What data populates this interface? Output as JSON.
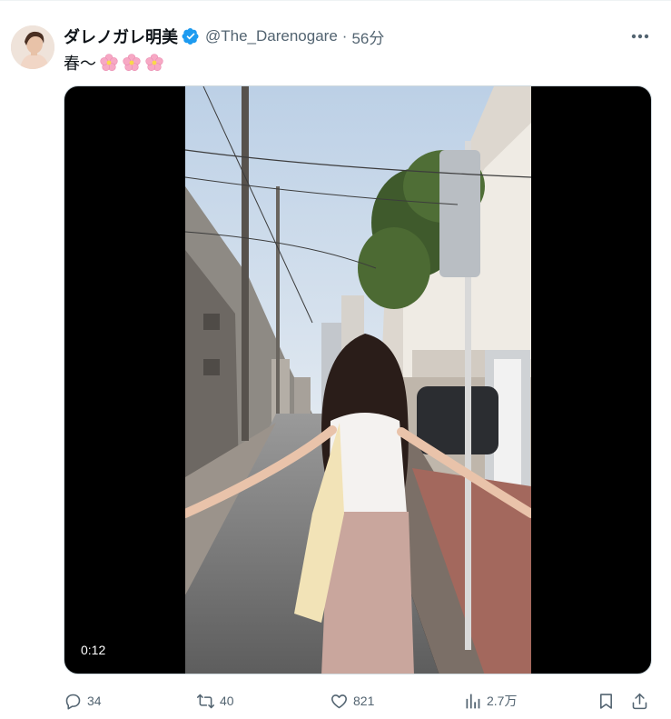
{
  "post": {
    "display_name": "ダレノガレ明美",
    "handle": "@The_Darenogare",
    "separator": "·",
    "time": "56分",
    "text": "春〜",
    "blossom_icons": [
      "blossom-icon",
      "blossom-icon",
      "blossom-icon"
    ]
  },
  "video": {
    "duration": "0:12"
  },
  "actions": {
    "reply_count": "34",
    "repost_count": "40",
    "like_count": "821",
    "views_count": "2.7万"
  },
  "icons": {
    "verified": "verified-badge-icon",
    "more": "more-icon",
    "reply": "reply-icon",
    "repost": "repost-icon",
    "like": "like-icon",
    "views": "views-icon",
    "bookmark": "bookmark-icon",
    "share": "share-icon"
  },
  "colors": {
    "verified_blue": "#1d9bf0",
    "muted_text": "#536471",
    "text": "#0f1419",
    "blossom": "#f7a8c4"
  }
}
